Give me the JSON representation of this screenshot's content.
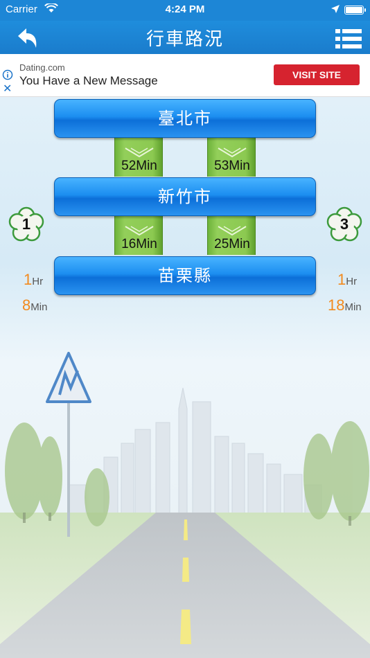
{
  "status": {
    "carrier": "Carrier",
    "time": "4:24 PM"
  },
  "nav": {
    "title": "行車路況"
  },
  "ad": {
    "source": "Dating.com",
    "message": "You Have a New Message",
    "cta": "VISIT SITE",
    "close": "✕"
  },
  "cities": [
    {
      "name": "臺北市"
    },
    {
      "name": "新竹市"
    },
    {
      "name": "苗栗縣"
    }
  ],
  "segments": [
    {
      "time": "52Min"
    },
    {
      "time": "53Min"
    },
    {
      "time": "16Min"
    },
    {
      "time": "25Min"
    }
  ],
  "routes": {
    "left": {
      "number": "1",
      "hours": "1",
      "hours_unit": "Hr",
      "minutes": "8",
      "minutes_unit": "Min"
    },
    "right": {
      "number": "3",
      "hours": "1",
      "hours_unit": "Hr",
      "minutes": "18",
      "minutes_unit": "Min"
    }
  },
  "colors": {
    "nav": "#1d86d6",
    "city_button": "#1c8ef0",
    "segment": "#8cc951",
    "time_value": "#f28a1d",
    "ad_cta": "#d6232f"
  }
}
